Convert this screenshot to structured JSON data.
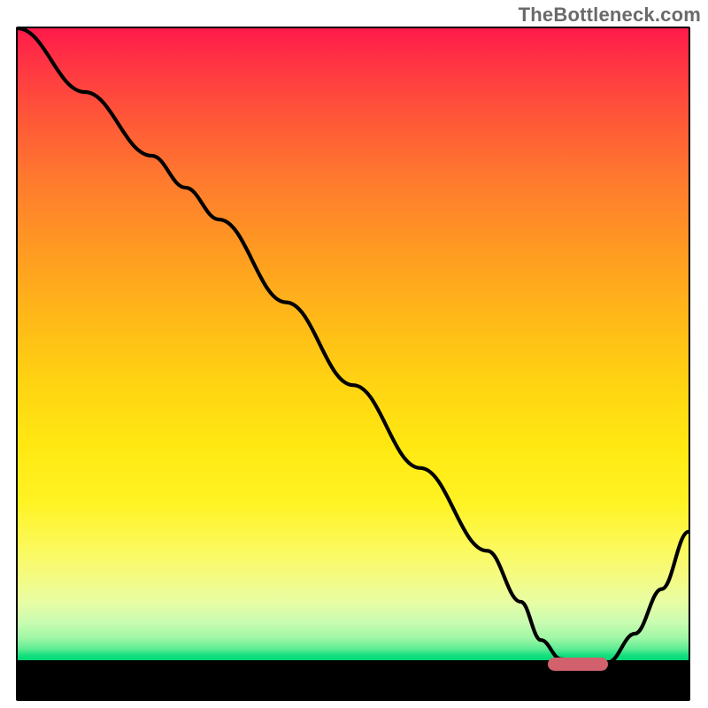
{
  "watermark": "TheBottleneck.com",
  "colors": {
    "top": "#ff1a4b",
    "mid": "#ffd312",
    "bottom": "#00d877",
    "curve": "#000000",
    "marker": "#d1626d",
    "frame": "#000000"
  },
  "chart_data": {
    "type": "line",
    "title": "",
    "xlabel": "",
    "ylabel": "",
    "xlim": [
      0,
      100
    ],
    "ylim": [
      0,
      100
    ],
    "grid": false,
    "legend": false,
    "note": "Values estimated from pixel positions; no axis tick labels visible.",
    "x": [
      0,
      10,
      20,
      25,
      30,
      40,
      50,
      60,
      70,
      75,
      78,
      81,
      84,
      88,
      92,
      96,
      100
    ],
    "y": [
      100,
      90,
      80,
      75,
      70,
      57,
      44,
      31,
      18,
      10,
      4,
      1,
      0.5,
      0.5,
      5,
      12,
      21
    ],
    "marker": {
      "x_start": 79,
      "x_end": 88,
      "y": 0
    }
  }
}
